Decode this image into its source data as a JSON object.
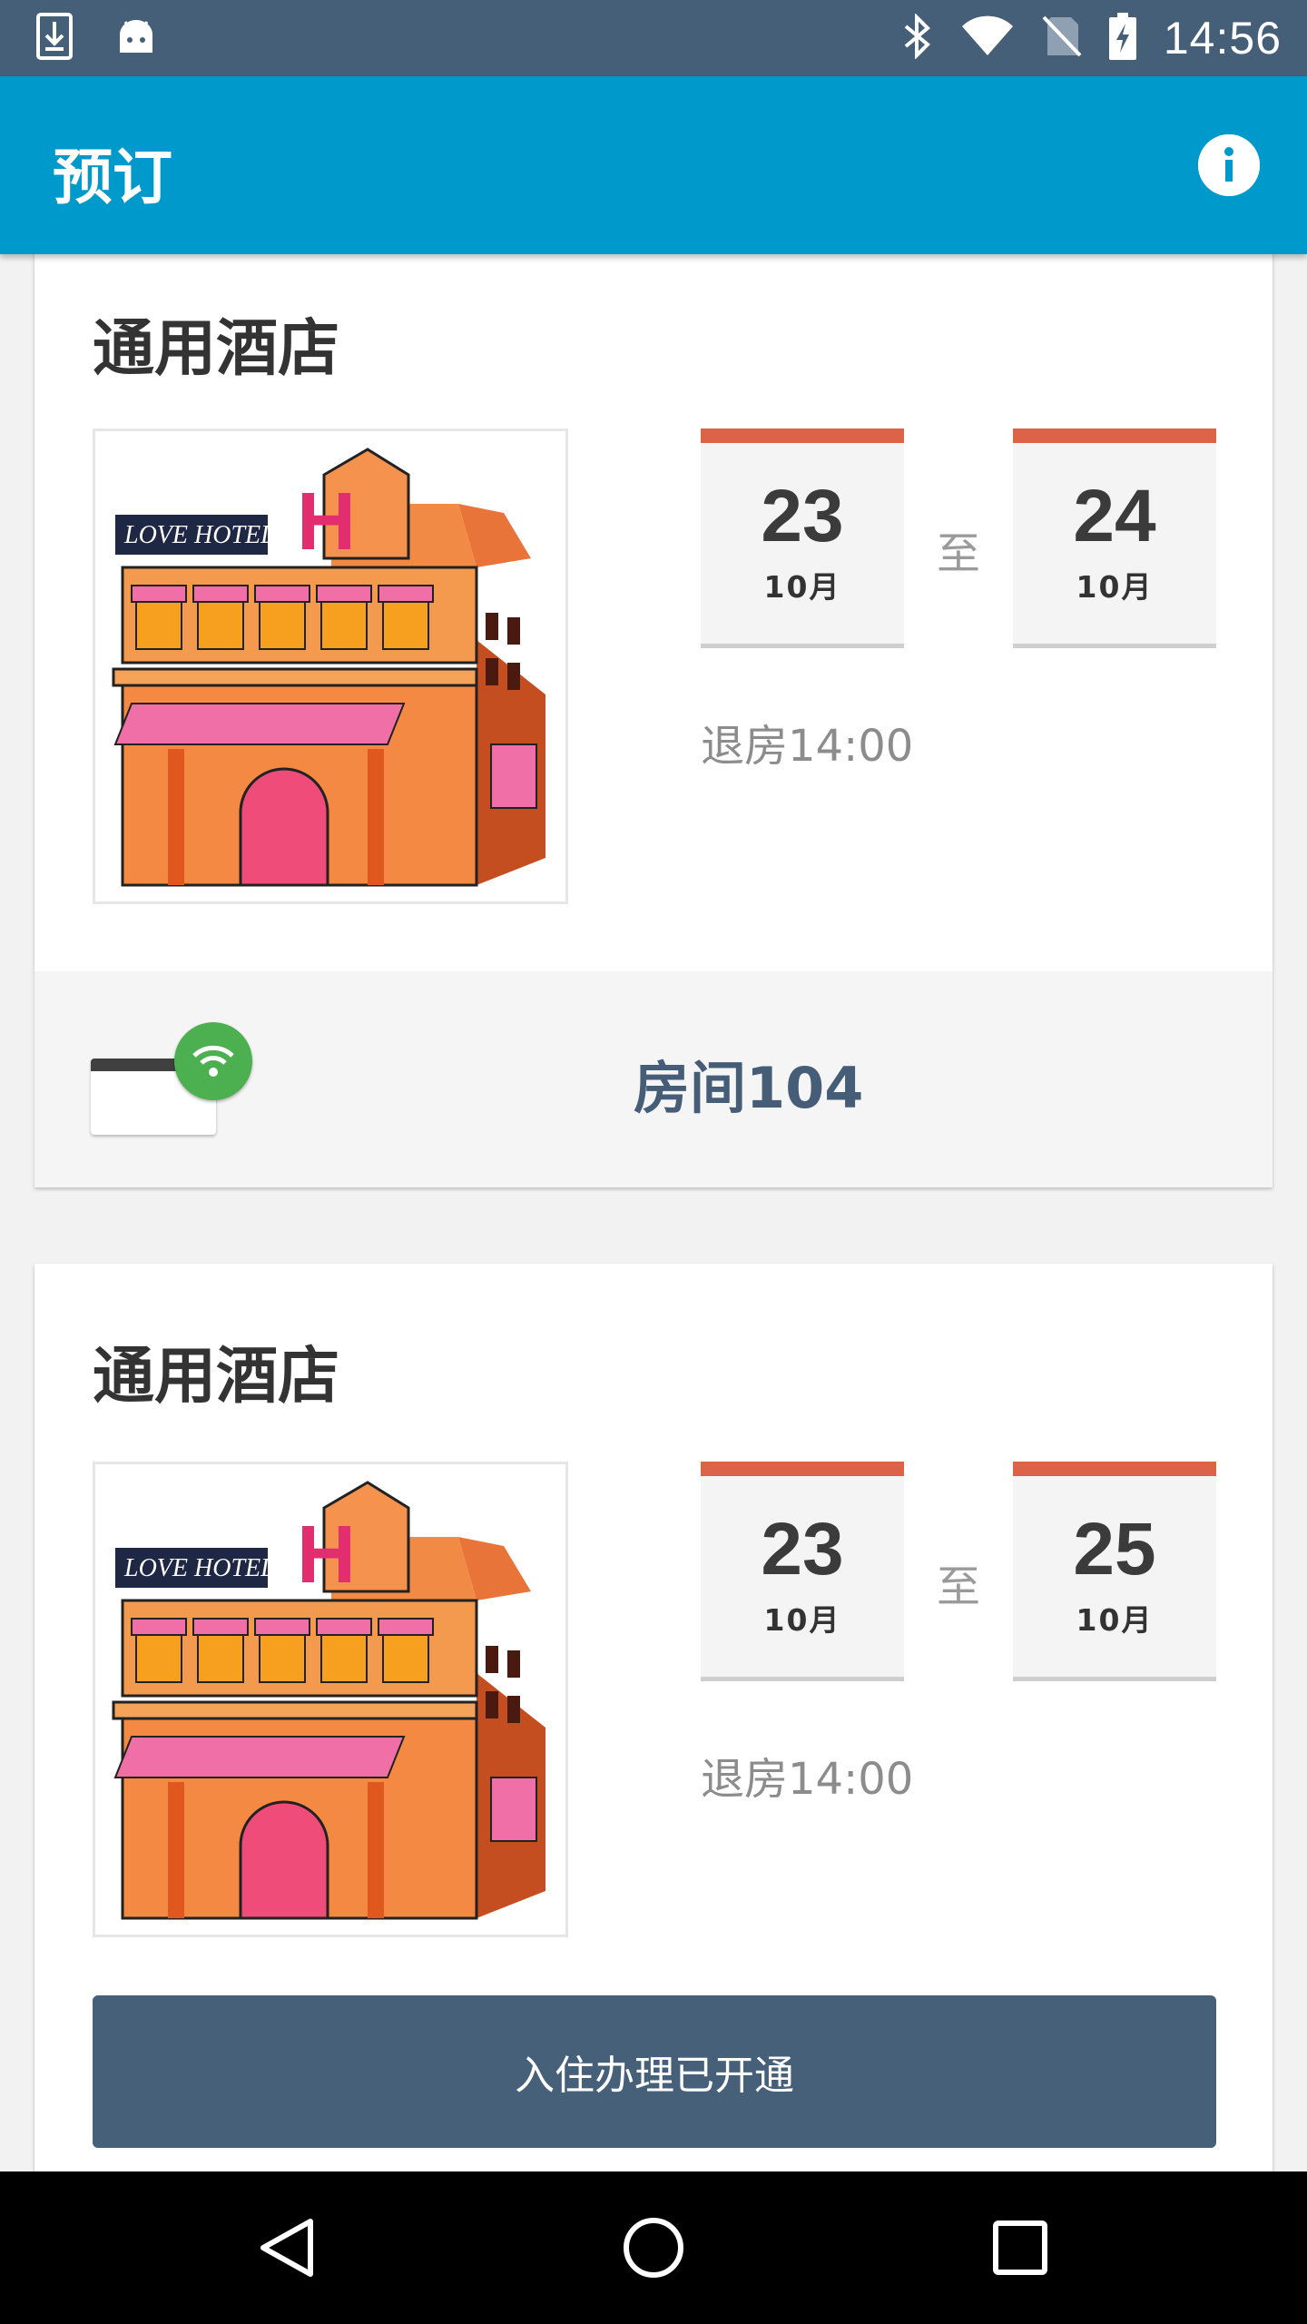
{
  "status_bar": {
    "time": "14:56",
    "icons": [
      "download-icon",
      "android-icon",
      "bluetooth-icon",
      "wifi-icon",
      "no-sim-icon",
      "battery-charging-icon"
    ]
  },
  "app_bar": {
    "title": "预订",
    "info_icon": "info-icon"
  },
  "bookings": [
    {
      "hotel_name": "通用酒店",
      "image_icon": "hotel-building-illustration",
      "image_sign_text": "LOVE HOTEL",
      "image_badge_letter": "H",
      "check_in": {
        "day": "23",
        "month": "10月"
      },
      "separator": "至",
      "check_out": {
        "day": "24",
        "month": "10月"
      },
      "checkout_time": "退房14:00",
      "room": "房间104",
      "key_icon": "key-card-wifi-icon"
    },
    {
      "hotel_name": "通用酒店",
      "image_icon": "hotel-building-illustration",
      "image_sign_text": "LOVE HOTEL",
      "image_badge_letter": "H",
      "check_in": {
        "day": "23",
        "month": "10月"
      },
      "separator": "至",
      "check_out": {
        "day": "25",
        "month": "10月"
      },
      "checkout_time": "退房14:00",
      "action_button": "入住办理已开通"
    }
  ],
  "nav_bar": {
    "icons": [
      "back-icon",
      "home-icon",
      "recents-icon"
    ]
  },
  "colors": {
    "status_bar": "#455F78",
    "app_bar": "#0099CC",
    "date_accent": "#DD6348",
    "room_text": "#465D78",
    "button": "#456078",
    "wifi_badge": "#4CAF50"
  }
}
